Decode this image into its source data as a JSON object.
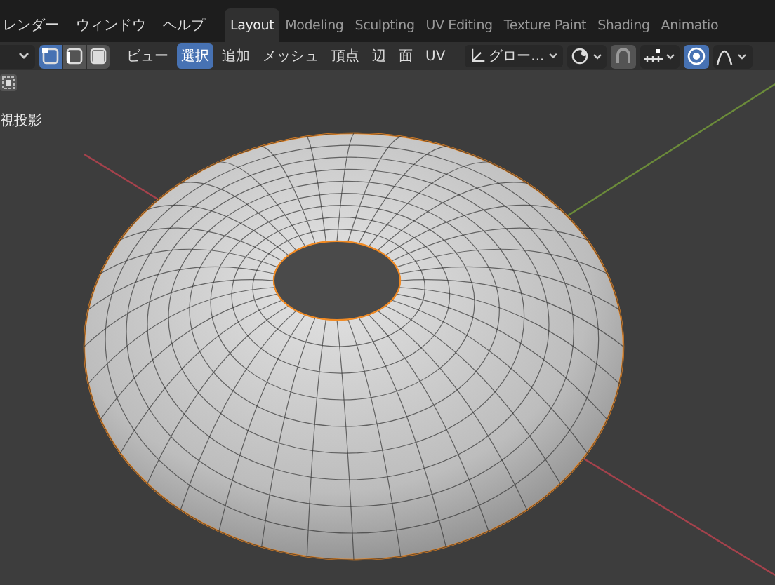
{
  "menus": [
    {
      "label": "レンダー"
    },
    {
      "label": "ウィンドウ"
    },
    {
      "label": "ヘルプ"
    }
  ],
  "workspace_tabs": [
    {
      "label": "Layout",
      "selected": true
    },
    {
      "label": "Modeling",
      "selected": false
    },
    {
      "label": "Sculpting",
      "selected": false
    },
    {
      "label": "UV Editing",
      "selected": false
    },
    {
      "label": "Texture Paint",
      "selected": false
    },
    {
      "label": "Shading",
      "selected": false
    },
    {
      "label": "Animatio",
      "selected": false
    }
  ],
  "select_modes": [
    {
      "kind": "vertex",
      "selected": true
    },
    {
      "kind": "edge",
      "selected": false
    },
    {
      "kind": "face",
      "selected": false
    }
  ],
  "header_menus": [
    {
      "label": "ビュー",
      "selected": false
    },
    {
      "label": "選択",
      "selected": true
    },
    {
      "label": "追加",
      "selected": false
    },
    {
      "label": "メッシュ",
      "selected": false
    },
    {
      "label": "頂点",
      "selected": false
    },
    {
      "label": "辺",
      "selected": false
    },
    {
      "label": "面",
      "selected": false
    },
    {
      "label": "UV",
      "selected": false
    }
  ],
  "orientation": {
    "value": "グロー..."
  },
  "snap": {
    "on": false
  },
  "proportional_editing": {
    "on": true
  },
  "viewport": {
    "view_label": "視投影"
  }
}
